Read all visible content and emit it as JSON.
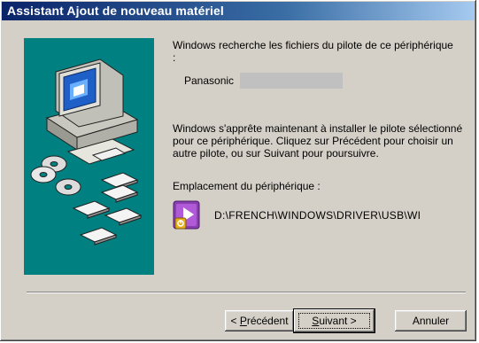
{
  "window": {
    "title": "Assistant Ajout de nouveau matériel"
  },
  "content": {
    "search_text": "Windows recherche les fichiers du pilote de ce périphérique :",
    "device_name": "Panasonic",
    "install_text": "Windows s'apprête maintenant à installer le pilote sélectionné pour ce périphérique. Cliquez sur Précédent pour choisir un autre pilote, ou sur Suivant pour poursuivre.",
    "location_label": "Emplacement du périphérique :",
    "location_path": "D:\\FRENCH\\WINDOWS\\DRIVER\\USB\\WI",
    "location_icon": "setup-file-icon"
  },
  "buttons": {
    "back_prefix": "< ",
    "back_accel": "P",
    "back_rest": "récédent",
    "next_accel": "S",
    "next_rest": "uivant >",
    "cancel": "Annuler"
  },
  "colors": {
    "titlebar_start": "#0a246a",
    "titlebar_end": "#a6caf0",
    "art_background": "#008080",
    "dialog_face": "#d4d0c8"
  },
  "art": {
    "items": [
      "computer-icon",
      "cd-disc-icon",
      "floppy-disk-icon"
    ]
  }
}
